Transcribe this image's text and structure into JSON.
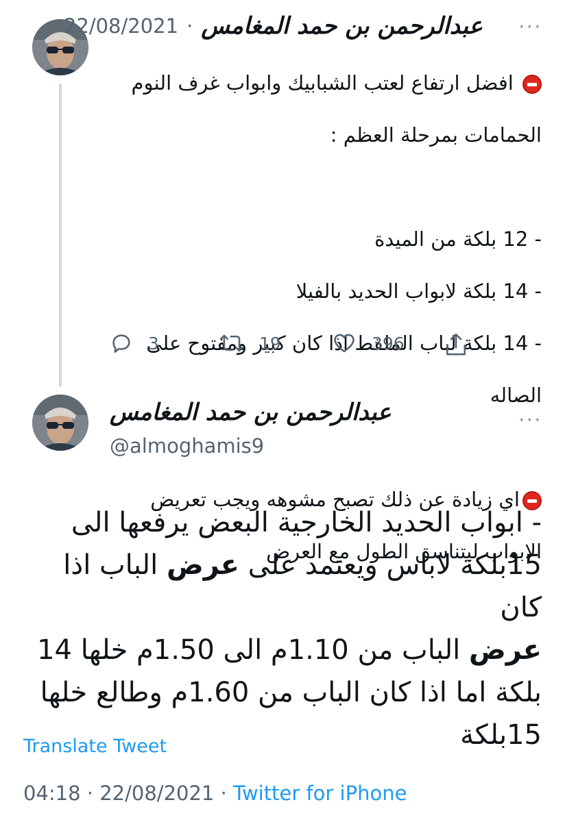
{
  "thread_tweet": {
    "display_name": "عبدالرحمن بن حمد المغامس",
    "separator": "·",
    "date": "22/08/2021",
    "more_icon": "more-horizontal-icon",
    "line1": "افضل ارتفاع لعتب الشبابيك وابواب غرف النوم",
    "line2": "الحمامات بمرحلة العظم :",
    "line3": "- 12 بلكة من الميدة",
    "line4": "- 14 بلكة لابواب الحديد بالفيلا",
    "line5": "- 14 بلكة لباب الملقط اذا كان كبير ومفتوح على",
    "line6": "الصاله",
    "line7": "اي زيادة عن ذلك تصبح مشوهه ويجب تعريض",
    "line8": "الابواب ليتناسق الطول مع العرض",
    "actions": {
      "reply_count": "3",
      "retweet_count": "19",
      "like_count": "396"
    }
  },
  "main_tweet": {
    "display_name": "عبدالرحمن بن حمد المغامس",
    "handle": "@almoghamis9",
    "line1": "- ابواب الحديد الخارجية البعض يرفعها الى",
    "line2_pre": "15بلكة لاباس ويعتمد على ",
    "line2_bold": "عرض",
    "line2_post": " الباب اذا كان",
    "line3_bold": "عرض",
    "line3_post": " الباب من 1.10م الى 1.50م خلها 14",
    "line4": "بلكة اما اذا كان الباب من 1.60م وطالع خلها",
    "line5": "15بلكة",
    "translate_label": "Translate Tweet",
    "time": "04:18",
    "sep1": " · ",
    "date": "22/08/2021",
    "sep2": " · ",
    "source": "Twitter for iPhone"
  },
  "colors": {
    "accent": "#1d9bf0",
    "secondary_text": "#536471",
    "stop_icon": "#e0271f"
  }
}
